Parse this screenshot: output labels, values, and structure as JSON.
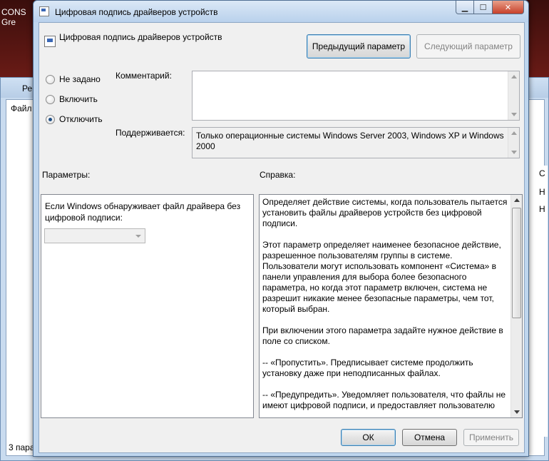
{
  "background": {
    "text_line1": "CONS",
    "text_line2": "Gre",
    "window_title": "Ре",
    "menu_label": "Файл",
    "status_text": "3 пара",
    "right_items": [
      "С",
      "Н",
      "Н"
    ]
  },
  "dialog": {
    "title": "Цифровая подпись драйверов устройств",
    "header_title": "Цифровая подпись драйверов устройств",
    "buttons": {
      "previous": "Предыдущий параметр",
      "next": "Следующий параметр",
      "ok": "ОК",
      "cancel": "Отмена",
      "apply": "Применить"
    },
    "radios": [
      {
        "label": "Не задано",
        "checked": false
      },
      {
        "label": "Включить",
        "checked": false
      },
      {
        "label": "Отключить",
        "checked": true
      }
    ],
    "comment_label": "Комментарий:",
    "comment_value": "",
    "supported_label": "Поддерживается:",
    "supported_value": "Только операционные системы Windows Server 2003, Windows XP и Windows 2000",
    "options_label": "Параметры:",
    "help_label": "Справка:",
    "options_text": "Если Windows обнаруживает файл драйвера без цифровой подписи:",
    "combo_value": "",
    "help_paragraphs": [
      "Определяет действие системы, когда пользователь пытается установить файлы драйверов устройств без цифровой подписи.",
      "Этот параметр определяет наименее безопасное действие, разрешенное пользователям группы в системе. Пользователи могут использовать компонент «Система» в панели управления для выбора более безопасного параметра, но когда этот параметр включен, система не разрешит никакие менее безопасные параметры, чем тот, который выбран.",
      "При включении этого параметра задайте нужное действие в поле со списком.",
      "--    «Пропустить». Предписывает системе продолжить установку даже при неподписанных файлах.",
      "--    «Предупредить». Уведомляет пользователя, что файлы не имеют цифровой подписи, и предоставляет пользователю"
    ]
  },
  "icons": {
    "title_icon": "policy-icon",
    "header_icon": "policy-icon",
    "minimize": "minimize-icon",
    "maximize": "maximize-icon",
    "close": "close-icon"
  },
  "colors": {
    "desktop": "#5a1512",
    "dialog_frame": "#bfd6ee",
    "close_button": "#c7402a",
    "client_bg": "#f0f0f0"
  }
}
